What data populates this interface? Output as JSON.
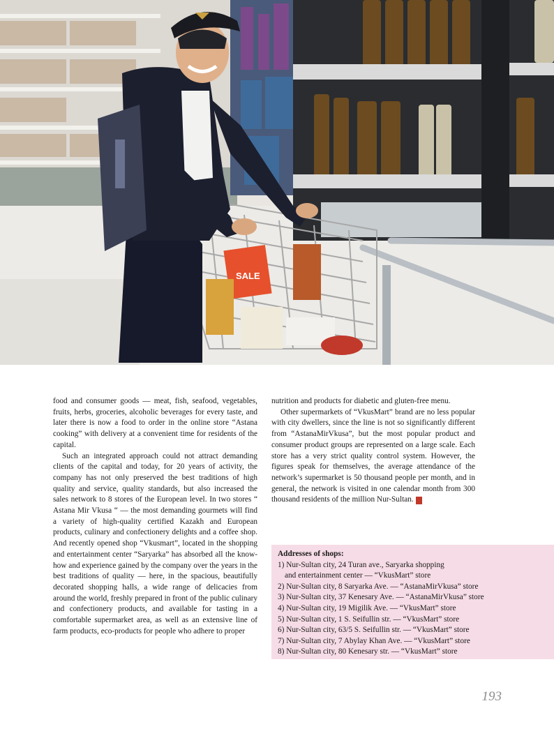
{
  "photo": {
    "cart_sign": "SALE"
  },
  "left_column": {
    "paragraphs": [
      "food and consumer goods — meat, fish, seafood, vegetables, fruits, herbs, groceries, alcoholic beverages for every taste, and later there is now a food to order in the online store “Astana cooking” with delivery at a convenient time for residents of the capital.",
      "Such an integrated approach could not attract demanding clients of the capital and today, for 20 years of activity, the company has not only preserved the best traditions of high quality and service, quality standards, but also increased the sales network to 8 stores of the European level. In two stores “ Astana Mir Vkusa “ — the most demanding gourmets will find a variety of high-quality certified Kazakh and European products, culinary and confectionery delights and a coffee shop. And recently opened shop “Vkusmart”, located in the shopping and entertainment center “Saryarka” has absorbed all the know-how and experience gained by the company over the years in the best traditions of quality — here, in the spacious, beautifully decorated shopping halls, a wide range of delicacies from around the world, freshly prepared in front of the public culinary and confectionery products, and available for tasting in a comfortable supermarket area, as well as an extensive line of farm products, eco-products for people who adhere to proper"
    ]
  },
  "right_column": {
    "paragraphs": [
      "nutrition and products for diabetic and gluten-free menu.",
      "Other supermarkets of “VkusMart” brand are no less popular with city dwellers, since the line is not so significantly different from “AstanaMirVkusa”, but the most popular product and consumer product groups are represented on a large scale. Each store has a very strict quality control system. However, the figures speak for themselves, the average attendance of the network’s supermarket is 50 thousand people per month, and in general, the network is visited in one calendar month from 300 thousand residents of the million Nur-Sultan."
    ],
    "end_mark": "E"
  },
  "addresses": {
    "title": "Addresses of shops:",
    "items": [
      "1) Nur-Sultan city, 24 Turan ave., Saryarka shopping",
      "and entertainment center — “VkusMart” store",
      "2) Nur-Sultan city, 8 Saryarka Ave. — “AstanaMirVkusa” store",
      "3) Nur-Sultan city, 37 Kenesary Ave. — “AstanaMirVkusa” store",
      "4) Nur-Sultan city, 19 Migilik Ave. — “VkusMart” store",
      "5) Nur-Sultan city, 1 S. Seifullin str. — “VkusMart” store",
      "6) Nur-Sultan city, 63/5 S. Seifullin str. — “VkusMart” store",
      "7) Nur-Sultan city, 7 Abylay Khan Ave. — “VkusMart” store",
      "8) Nur-Sultan city, 80 Kenesary str. — “VkusMart” store"
    ]
  },
  "page_number": "193",
  "colors": {
    "address_box_bg": "#f6dce6",
    "end_mark": "#c0392b",
    "page_number": "#8c8c8c"
  }
}
